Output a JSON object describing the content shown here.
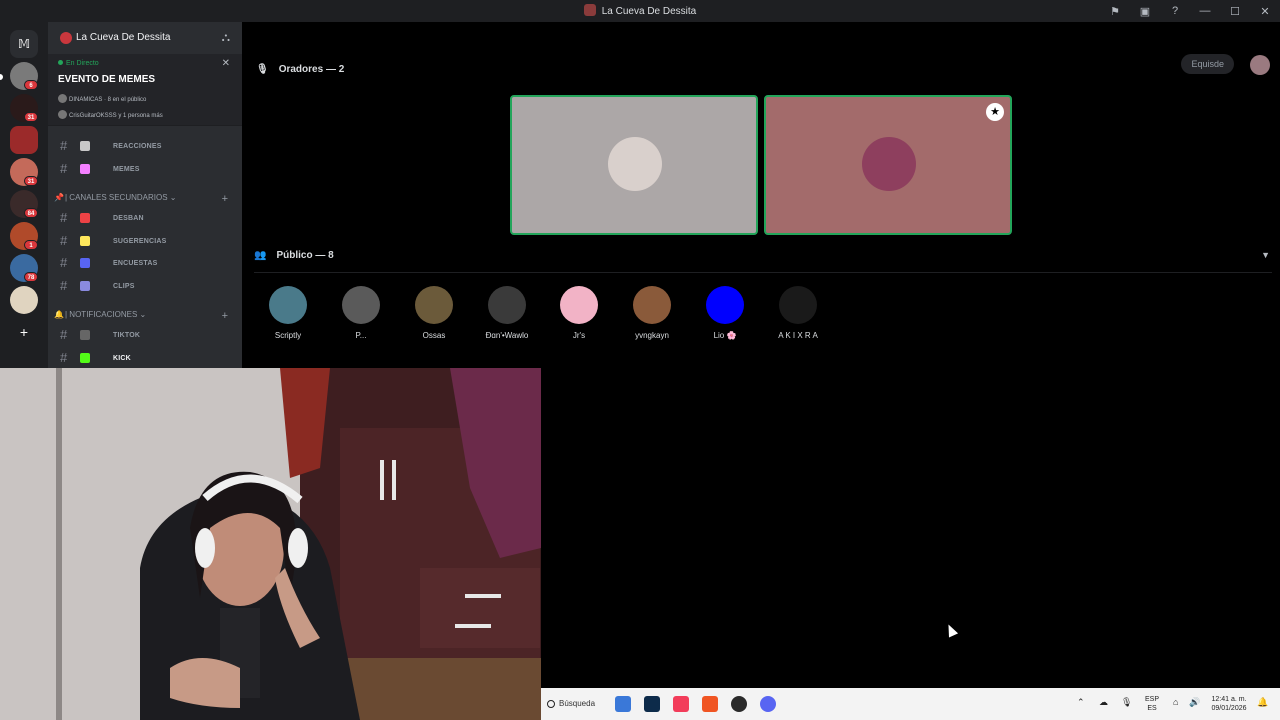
{
  "window": {
    "title": "La Cueva De Dessita",
    "icons": [
      "inbox-icon",
      "window-icon",
      "help-icon",
      "minimize-icon",
      "maximize-icon",
      "close-icon"
    ]
  },
  "server": {
    "name": "La Cueva De Dessita",
    "rail_badges": [
      "6",
      "31",
      "31",
      "84",
      "1",
      "78"
    ]
  },
  "event": {
    "status": "En Directo",
    "title": "EVENTO DE MEMES",
    "host_line": "DINAMICAS · 8 en el público",
    "speakers_line": "CrisGuitarOKSSS y 1 persona más"
  },
  "channels": {
    "top": [
      {
        "name": "REACCIONES",
        "color": "#c8c8c8"
      },
      {
        "name": "MEMES",
        "color": "#f47fff"
      }
    ],
    "cat_secundarios": "| CANALES SECUNDARIOS",
    "secundarios": [
      {
        "name": "DESBAN",
        "color": "#ed4245"
      },
      {
        "name": "SUGERENCIAS",
        "color": "#fee75c"
      },
      {
        "name": "ENCUESTAS",
        "color": "#5865f2"
      },
      {
        "name": "CLIPS",
        "color": "#8a8adf"
      }
    ],
    "cat_notificaciones": "| NOTIFICACIONES",
    "notificaciones": [
      {
        "name": "TIKTOK",
        "color": "#666666"
      },
      {
        "name": "KICK",
        "color": "#53fc18"
      }
    ]
  },
  "stage": {
    "speakers_label": "Oradores — 2",
    "audience_label": "Público — 8",
    "user_pill": "Equisde",
    "audience": [
      {
        "name": "Scriptly",
        "color": "#4a7a8a"
      },
      {
        "name": "P...",
        "color": "#5a5a5a"
      },
      {
        "name": "Ossas",
        "color": "#6b5a3a"
      },
      {
        "name": "Ɖɑn'•Wawlo",
        "color": "#3a3a3a"
      },
      {
        "name": "Jr's",
        "color": "#f2b3c6"
      },
      {
        "name": "yvngkayn",
        "color": "#8a5a3a"
      },
      {
        "name": "Lio 🌸",
        "color": "#0000ff"
      },
      {
        "name": "A K I X R A",
        "color": "#1a1a1a"
      }
    ]
  },
  "taskbar": {
    "search": "Búsqueda",
    "lang": "ESP",
    "region": "ES",
    "time": "12:41 a. m.",
    "date": "09/01/2026"
  }
}
